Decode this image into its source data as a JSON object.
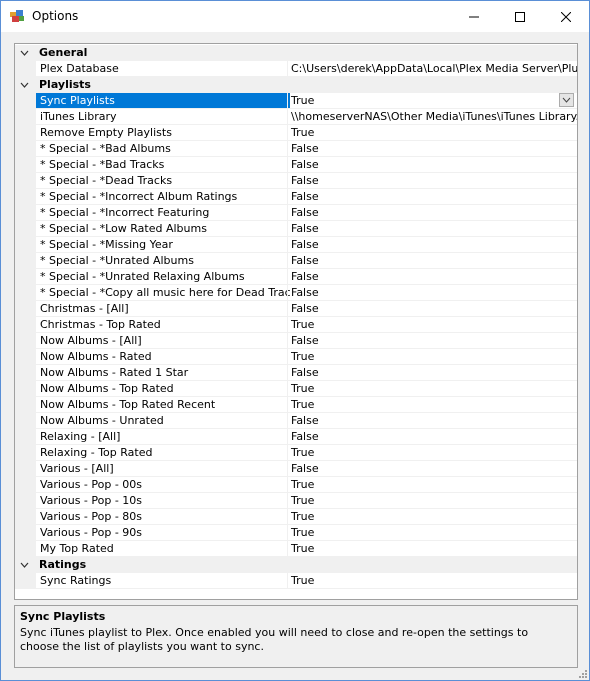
{
  "window": {
    "title": "Options",
    "minimize_icon": "minimize-icon",
    "maximize_icon": "maximize-icon",
    "close_icon": "close-icon"
  },
  "grid": {
    "categories": [
      {
        "label": "General",
        "expanded": true,
        "properties": [
          {
            "name": "Plex Database",
            "value": "C:\\Users\\derek\\AppData\\Local\\Plex Media Server\\Plug-in S"
          }
        ]
      },
      {
        "label": "Playlists",
        "expanded": true,
        "properties": [
          {
            "name": "Sync Playlists",
            "value": "True",
            "selected": true,
            "dropdown": true
          },
          {
            "name": "iTunes Library",
            "value": "\\\\homeserverNAS\\Other Media\\iTunes\\iTunes Library.xml"
          },
          {
            "name": "Remove Empty Playlists",
            "value": "True"
          },
          {
            "name": "* Special - *Bad Albums",
            "value": "False"
          },
          {
            "name": "* Special - *Bad Tracks",
            "value": "False"
          },
          {
            "name": "* Special - *Dead Tracks",
            "value": "False"
          },
          {
            "name": "* Special - *Incorrect Album Ratings",
            "value": "False"
          },
          {
            "name": "* Special - *Incorrect Featuring",
            "value": "False"
          },
          {
            "name": "* Special - *Low Rated Albums",
            "value": "False"
          },
          {
            "name": "* Special - *Missing Year",
            "value": "False"
          },
          {
            "name": "* Special - *Unrated Albums",
            "value": "False"
          },
          {
            "name": "* Special - *Unrated Relaxing Albums",
            "value": "False"
          },
          {
            "name": "* Special - *Copy all music here for Dead Track",
            "value": "False"
          },
          {
            "name": "Christmas - [All]",
            "value": "False"
          },
          {
            "name": "Christmas - Top Rated",
            "value": "True"
          },
          {
            "name": "Now Albums - [All]",
            "value": "False"
          },
          {
            "name": "Now Albums - Rated",
            "value": "True"
          },
          {
            "name": "Now Albums - Rated 1 Star",
            "value": "False"
          },
          {
            "name": "Now Albums - Top Rated",
            "value": "True"
          },
          {
            "name": "Now Albums - Top Rated Recent",
            "value": "True"
          },
          {
            "name": "Now Albums - Unrated",
            "value": "False"
          },
          {
            "name": "Relaxing - [All]",
            "value": "False"
          },
          {
            "name": "Relaxing - Top Rated",
            "value": "True"
          },
          {
            "name": "Various - [All]",
            "value": "False"
          },
          {
            "name": "Various - Pop - 00s",
            "value": "True"
          },
          {
            "name": "Various - Pop - 10s",
            "value": "True"
          },
          {
            "name": "Various - Pop - 80s",
            "value": "True"
          },
          {
            "name": "Various - Pop - 90s",
            "value": "True"
          },
          {
            "name": "My Top Rated",
            "value": "True"
          }
        ]
      },
      {
        "label": "Ratings",
        "expanded": true,
        "properties": [
          {
            "name": "Sync Ratings",
            "value": "True"
          }
        ]
      }
    ]
  },
  "help": {
    "title": "Sync Playlists",
    "description": "Sync iTunes playlist to Plex. Once enabled you will need to close and re-open the settings to choose the list of playlists you want to sync."
  },
  "colors": {
    "selection": "#0078d7",
    "border": "#a0a0a0",
    "category_bg": "#f0f0f0"
  }
}
